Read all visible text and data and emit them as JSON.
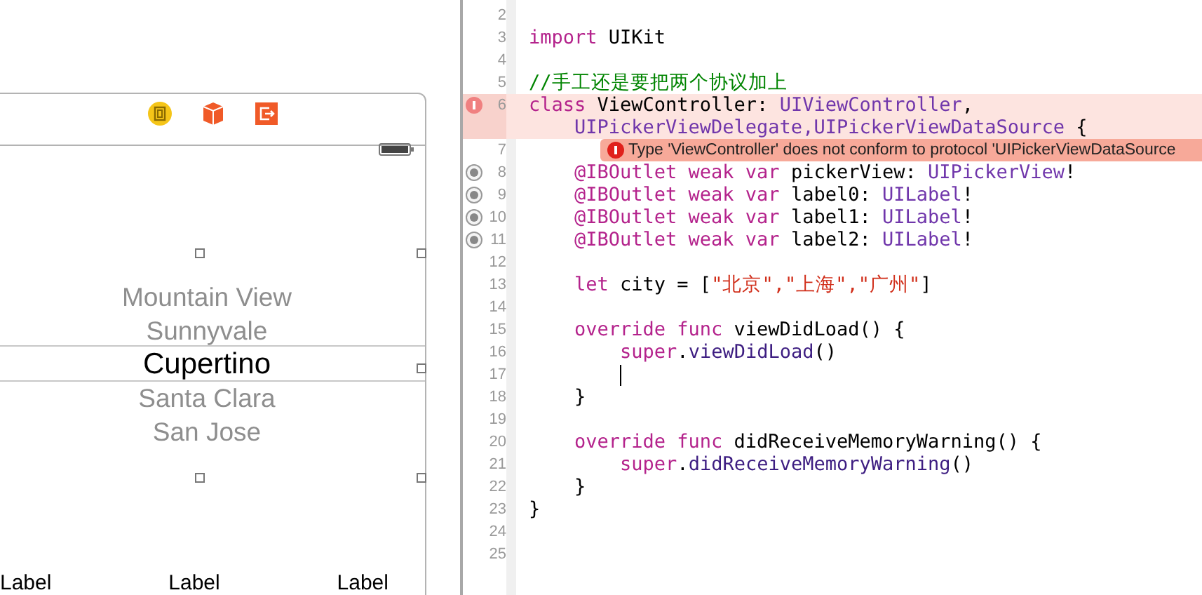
{
  "canvas": {
    "toolbar_icons": [
      {
        "kind": "controller"
      },
      {
        "kind": "cube"
      },
      {
        "kind": "exit"
      }
    ],
    "picker": {
      "items": [
        {
          "text": "Mountain View",
          "selected": false
        },
        {
          "text": "Sunnyvale",
          "selected": false
        },
        {
          "text": "Cupertino",
          "selected": true
        },
        {
          "text": "Santa Clara",
          "selected": false
        },
        {
          "text": "San Jose",
          "selected": false
        }
      ]
    },
    "labels": [
      "Label",
      "Label",
      "Label"
    ]
  },
  "editor": {
    "rows": [
      {
        "number": "2",
        "tokens": []
      },
      {
        "number": "3",
        "tokens": [
          {
            "text": "import",
            "kind": "keyword"
          },
          {
            "text": " UIKit",
            "kind": "plain"
          }
        ]
      },
      {
        "number": "4",
        "tokens": []
      },
      {
        "number": "5",
        "tokens": [
          {
            "text": "//手工还是要把两个协议加上",
            "kind": "comment"
          }
        ]
      },
      {
        "number": "6",
        "error": true,
        "tokens": [
          {
            "text": "class",
            "kind": "keyword"
          },
          {
            "text": " ViewController: ",
            "kind": "plain"
          },
          {
            "text": "UIViewController",
            "kind": "type"
          },
          {
            "text": ",",
            "kind": "plain"
          }
        ]
      },
      {
        "error": true,
        "tokens": [
          {
            "text": "    UIPickerViewDelegate,",
            "kind": "type"
          },
          {
            "text": "UIPickerViewDataSource",
            "kind": "type"
          },
          {
            "text": " {",
            "kind": "plain"
          }
        ]
      },
      {
        "number": "7",
        "annotation": "Type 'ViewController' does not conform to protocol 'UIPickerViewDataSource",
        "tokens": []
      },
      {
        "number": "8",
        "outlet": true,
        "tokens": [
          {
            "text": "    @IBOutlet weak var",
            "kind": "keyword"
          },
          {
            "text": " pickerView: ",
            "kind": "plain"
          },
          {
            "text": "UIPickerView",
            "kind": "type"
          },
          {
            "text": "!",
            "kind": "plain"
          }
        ]
      },
      {
        "number": "9",
        "outlet": true,
        "tokens": [
          {
            "text": "    @IBOutlet weak var",
            "kind": "keyword"
          },
          {
            "text": " label0: ",
            "kind": "plain"
          },
          {
            "text": "UILabel",
            "kind": "type"
          },
          {
            "text": "!",
            "kind": "plain"
          }
        ]
      },
      {
        "number": "10",
        "outlet": true,
        "tokens": [
          {
            "text": "    @IBOutlet weak var",
            "kind": "keyword"
          },
          {
            "text": " label1: ",
            "kind": "plain"
          },
          {
            "text": "UILabel",
            "kind": "type"
          },
          {
            "text": "!",
            "kind": "plain"
          }
        ]
      },
      {
        "number": "11",
        "outlet": true,
        "tokens": [
          {
            "text": "    @IBOutlet weak var",
            "kind": "keyword"
          },
          {
            "text": " label2: ",
            "kind": "plain"
          },
          {
            "text": "UILabel",
            "kind": "type"
          },
          {
            "text": "!",
            "kind": "plain"
          }
        ]
      },
      {
        "number": "12",
        "tokens": []
      },
      {
        "number": "13",
        "tokens": [
          {
            "text": "    let",
            "kind": "keyword"
          },
          {
            "text": " city = [",
            "kind": "plain"
          },
          {
            "text": "\"北京\",",
            "kind": "string"
          },
          {
            "text": "\"上海\",",
            "kind": "string"
          },
          {
            "text": "\"广州\"",
            "kind": "string"
          },
          {
            "text": "]",
            "kind": "plain"
          }
        ]
      },
      {
        "number": "14",
        "tokens": []
      },
      {
        "number": "15",
        "tokens": [
          {
            "text": "    override func",
            "kind": "keyword"
          },
          {
            "text": " viewDidLoad() {",
            "kind": "plain"
          }
        ]
      },
      {
        "number": "16",
        "tokens": [
          {
            "text": "        super",
            "kind": "keyword"
          },
          {
            "text": ".",
            "kind": "plain"
          },
          {
            "text": "viewDidLoad",
            "kind": "method"
          },
          {
            "text": "()",
            "kind": "plain"
          }
        ]
      },
      {
        "number": "17",
        "cursor": true,
        "tokens": []
      },
      {
        "number": "18",
        "tokens": [
          {
            "text": "    }",
            "kind": "plain"
          }
        ]
      },
      {
        "number": "19",
        "tokens": []
      },
      {
        "number": "20",
        "tokens": [
          {
            "text": "    override func",
            "kind": "keyword"
          },
          {
            "text": " didReceiveMemoryWarning() {",
            "kind": "plain"
          }
        ]
      },
      {
        "number": "21",
        "tokens": [
          {
            "text": "        super",
            "kind": "keyword"
          },
          {
            "text": ".",
            "kind": "plain"
          },
          {
            "text": "didReceiveMemoryWarning",
            "kind": "method"
          },
          {
            "text": "()",
            "kind": "plain"
          }
        ]
      },
      {
        "number": "22",
        "tokens": [
          {
            "text": "    }",
            "kind": "plain"
          }
        ]
      },
      {
        "number": "23",
        "tokens": [
          {
            "text": "}",
            "kind": "plain"
          }
        ]
      },
      {
        "number": "24",
        "tokens": []
      },
      {
        "number": "25",
        "tokens": []
      }
    ]
  }
}
